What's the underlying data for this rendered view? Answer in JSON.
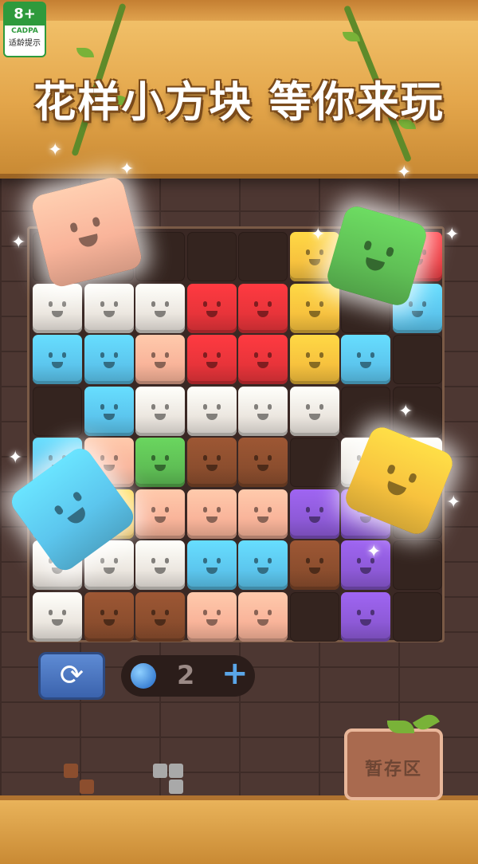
{
  "age_rating": {
    "number": "8+",
    "org": "CADPA",
    "label": "适龄提示"
  },
  "title": "花样小方块 等你来玩",
  "colors": {
    "white": "#ece7e0",
    "red": "#e8343a",
    "yellow": "#f7c23e",
    "blue": "#5cc6ee",
    "peach": "#f9b49a",
    "green": "#5fbf55",
    "brown": "#8c4e2e",
    "purple": "#8e5ad8"
  },
  "board": {
    "rows": [
      [
        "e",
        "e",
        "e",
        "e",
        "e",
        "yellow",
        "e",
        "red"
      ],
      [
        "white",
        "white",
        "white",
        "red",
        "red",
        "yellow",
        "e",
        "blue"
      ],
      [
        "blue",
        "blue",
        "peach",
        "red",
        "red",
        "yellow",
        "blue",
        "e"
      ],
      [
        "e",
        "blue",
        "white",
        "white",
        "white",
        "white",
        "e",
        "e"
      ],
      [
        "blue",
        "peach",
        "green",
        "brown",
        "brown",
        "e",
        "white",
        "white"
      ],
      [
        "blue",
        "yellow",
        "peach",
        "peach",
        "peach",
        "purple",
        "purple",
        "e"
      ],
      [
        "white",
        "white",
        "white",
        "blue",
        "blue",
        "brown",
        "purple",
        "e"
      ],
      [
        "white",
        "brown",
        "brown",
        "peach",
        "peach",
        "e",
        "purple",
        "e"
      ]
    ]
  },
  "floating_blocks": [
    {
      "name": "angry-peach-block",
      "color": "peach"
    },
    {
      "name": "green-block",
      "color": "green"
    },
    {
      "name": "blue-block",
      "color": "blue"
    },
    {
      "name": "yellow-block",
      "color": "yellow"
    }
  ],
  "controls": {
    "refresh_icon": "refresh-icon",
    "orb_icon": "blue-orb-icon",
    "count": "2",
    "plus_label": "+"
  },
  "storage": {
    "label": "暂存区"
  }
}
